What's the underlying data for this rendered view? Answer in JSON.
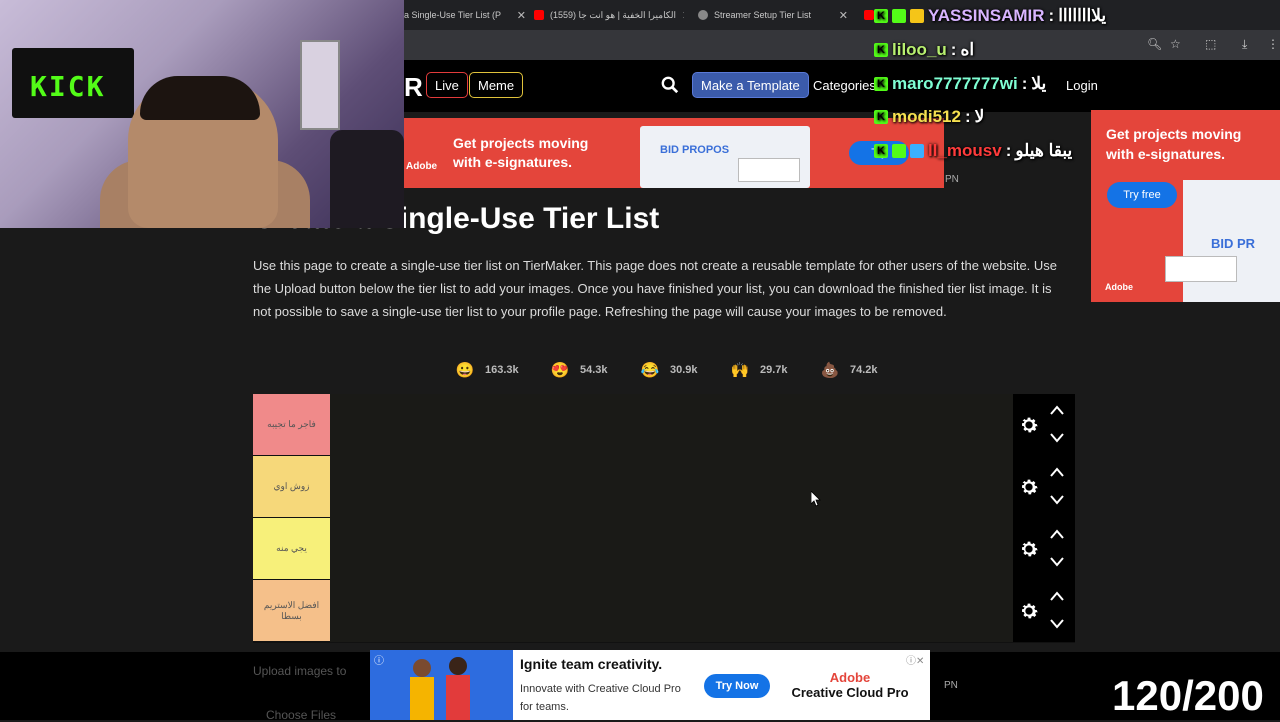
{
  "browser": {
    "tabs": [
      {
        "title": "a Single-Use Tier List (P"
      },
      {
        "title": "(1559) الكاميرا الخفية | هو انت جا"
      },
      {
        "title": "Streamer Setup Tier List"
      }
    ]
  },
  "site": {
    "logo_fragment": "R",
    "live_label": "Live",
    "meme_label": "Meme",
    "make_template_label": "Make a Template",
    "categories_label": "Categories",
    "login_label": "Login"
  },
  "ads": {
    "top_banner": {
      "headline": "Get projects moving with e-signatures.",
      "cta": "Try",
      "brand": "Adobe",
      "doc_text": "BID PROPOS"
    },
    "side_banner": {
      "headline": "Get projects moving with e-signatures.",
      "cta": "Try free",
      "brand": "Adobe",
      "doc_text": "BID PR"
    },
    "ad_marker": "PN",
    "bottom_banner": {
      "headline": "Ignite team creativity.",
      "body": "Innovate with Creative Cloud Pro for teams.",
      "cta": "Try Now",
      "brand_line1": "Adobe",
      "brand_line2": "Creative Cloud Pro"
    }
  },
  "page": {
    "title": "Create a Single-Use Tier List",
    "description": "Use this page to create a single-use tier list on TierMaker. This page does not create a reusable template for other users of the website. Use the Upload button below the tier list to add your images. Once you have finished your list, you can download the finished tier list image. It is not possible to save a single-use tier list to your profile page. Refreshing the page will cause your images to be removed."
  },
  "reactions": [
    {
      "emoji": "😀",
      "count": "163.3k",
      "color": "#f5c518"
    },
    {
      "emoji": "😍",
      "count": "54.3k",
      "color": "#f5c518"
    },
    {
      "emoji": "😂",
      "count": "30.9k",
      "color": "#f5c518"
    },
    {
      "emoji": "🙌",
      "count": "29.7k",
      "color": "#f5c518"
    },
    {
      "emoji": "💩",
      "count": "74.2k",
      "color": "#8b4a2b"
    }
  ],
  "tiers": [
    {
      "label": "فاجر ما تجيبه",
      "color": "#f08a8a"
    },
    {
      "label": "زوش اوي",
      "color": "#f6d87a"
    },
    {
      "label": "يجي منه",
      "color": "#f7f07a"
    },
    {
      "label": "افضل الاستريم بسطا",
      "color": "#f5c08a"
    }
  ],
  "bottom": {
    "upload_text": "Upload images to",
    "choose_files": "Choose Files",
    "counter": "120/200"
  },
  "webcam": {
    "banner_text": "KICK"
  },
  "chat": [
    {
      "user": "YASSINSAMIR",
      "message": "يلاااااااا",
      "color": "#d8b4ff"
    },
    {
      "user": "liloo_u",
      "message": "اه",
      "color": "#b8f070"
    },
    {
      "user": "maro7777777wi",
      "message": "يلا",
      "color": "#7fffd4"
    },
    {
      "user": "modi512",
      "message": "لا",
      "color": "#f5e050"
    },
    {
      "user": "ll_mousv",
      "message": "يبقا هيلو",
      "color": "#ff3b3b"
    }
  ]
}
